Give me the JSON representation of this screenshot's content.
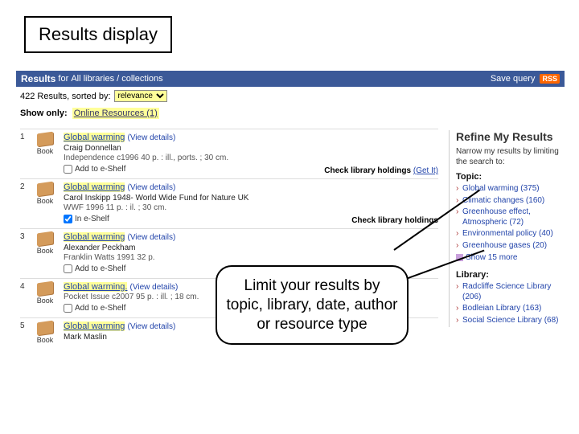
{
  "page_title": "Results display",
  "header": {
    "results_label": "Results",
    "for_label": "for",
    "scope": "All libraries / collections",
    "save_query": "Save query",
    "rss": "RSS"
  },
  "controls": {
    "count_text": "422 Results, sorted by:",
    "sort_value": "relevance",
    "show_only_label": "Show only:",
    "online_resources": "Online Resources (1)"
  },
  "results": [
    {
      "num": "1",
      "type": "Book",
      "title": "Global warming",
      "view": "(View details)",
      "author": "Craig Donnellan",
      "pub": "Independence c1996 40 p. : ill., ports. ; 30 cm.",
      "shelf_label": "Add to e-Shelf",
      "shelf_checked": false,
      "holdings": "Check library holdings",
      "get": "(Get It)"
    },
    {
      "num": "2",
      "type": "Book",
      "title": "Global warming",
      "view": "(View details)",
      "author": "Carol Inskipp 1948-  World Wide Fund for Nature UK",
      "pub": "WWF 1996 11 p. : il. ; 30 cm.",
      "shelf_label": "In e-Shelf",
      "shelf_checked": true,
      "holdings": "Check library holdings",
      "get": ""
    },
    {
      "num": "3",
      "type": "Book",
      "title": "Global warming",
      "view": "(View details)",
      "author": "Alexander Peckham",
      "pub": "Franklin Watts 1991 32 p.",
      "shelf_label": "Add to e-Shelf",
      "shelf_checked": false,
      "holdings": "",
      "get": ""
    },
    {
      "num": "4",
      "type": "Book",
      "title": "Global warming.",
      "view": "(View details)",
      "author": "",
      "pub": "Pocket Issue c2007 95 p. : ill. ; 18 cm.",
      "shelf_label": "Add to e-Shelf",
      "shelf_checked": false,
      "holdings": "",
      "get": ""
    },
    {
      "num": "5",
      "type": "Book",
      "title": "Global warming",
      "view": "(View details)",
      "author": "Mark Maslin",
      "pub": "",
      "shelf_label": "",
      "shelf_checked": false,
      "holdings": "",
      "get": ""
    }
  ],
  "sidebar": {
    "heading": "Refine My Results",
    "intro": "Narrow my results by limiting the search to:",
    "topic_head": "Topic:",
    "topics": [
      "Global warming (375)",
      "Climatic changes (160)",
      "Greenhouse effect, Atmospheric (72)",
      "Environmental policy (40)",
      "Greenhouse gases (20)"
    ],
    "show_more": "Show 15 more",
    "library_head": "Library:",
    "libraries": [
      "Radcliffe Science Library (206)",
      "Bodleian Library (163)",
      "Social Science Library (68)"
    ]
  },
  "callout": "Limit your results by topic, library, date, author or resource type"
}
